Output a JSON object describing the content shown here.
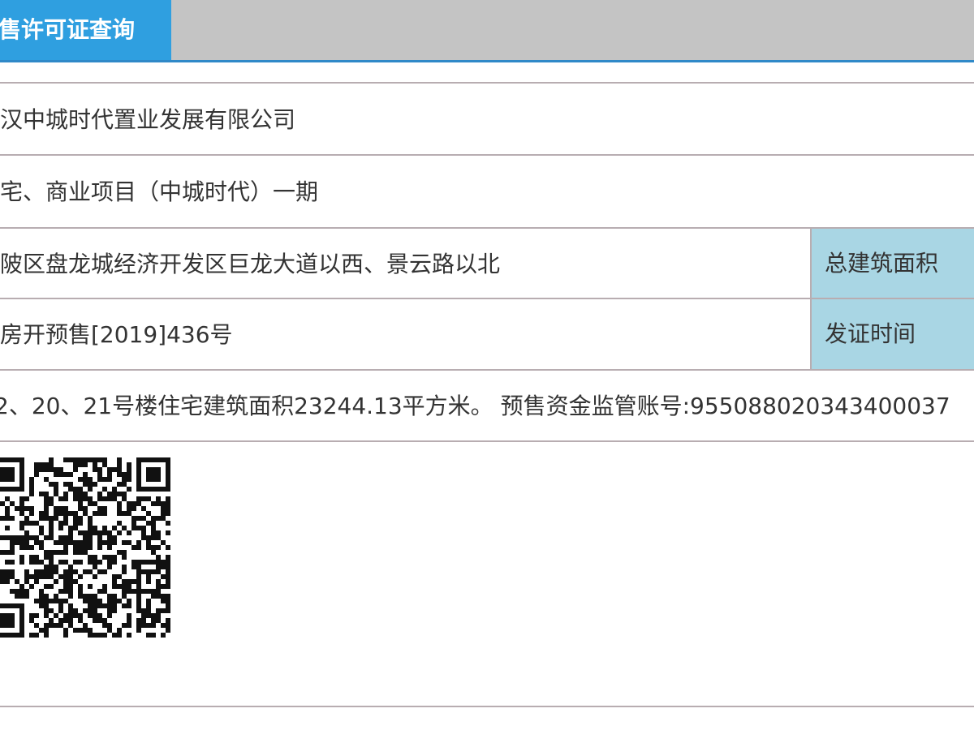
{
  "tabs": {
    "active_label": "售许可证查询"
  },
  "details": {
    "developer": "汉中城时代置业发展有限公司",
    "project_name": "宅、商业项目（中城时代）一期",
    "location": "陂区盘龙城经济开发区巨龙大道以西、景云路以北",
    "permit_number": "房开预售[2019]436号",
    "description": "2、20、21号楼住宅建筑面积23244.13平方米。 预售资金监管账号:955088020343400037",
    "total_area_label": "总建筑面积",
    "issue_date_label": "发证时间"
  },
  "colors": {
    "tab_active": "#2f9fe0",
    "tab_bar": "#c4c4c4",
    "label_bg": "#a9d6e4",
    "border": "#b8adb1"
  },
  "icons": {
    "qr": "qr-code"
  }
}
